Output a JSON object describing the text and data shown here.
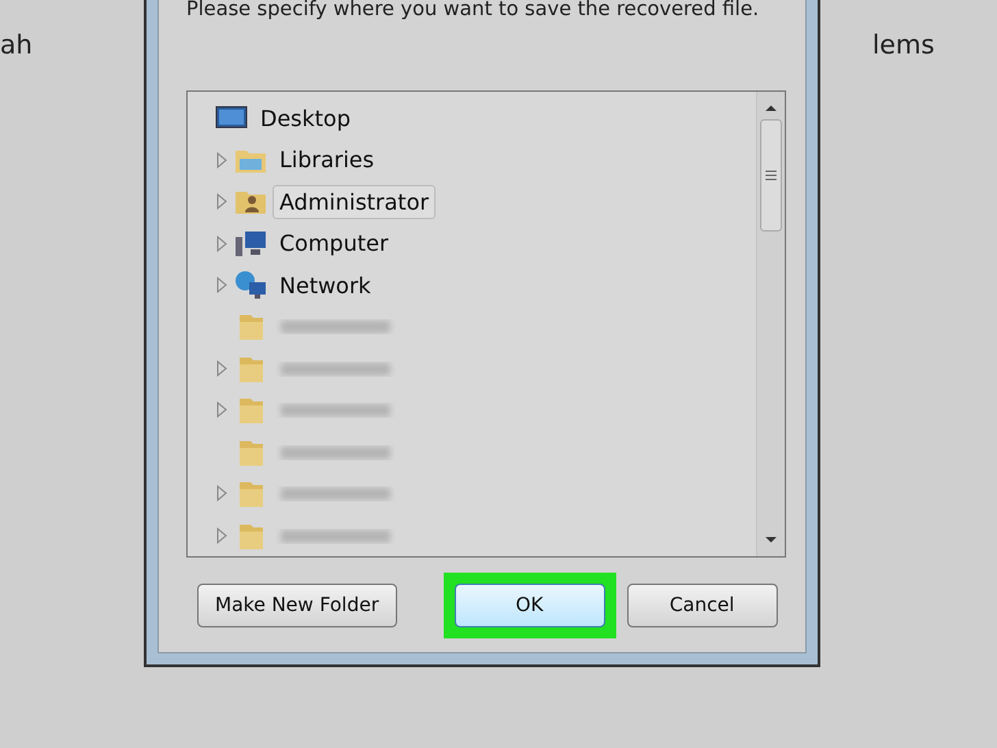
{
  "background": {
    "left_text": "ah",
    "right_text": "lems"
  },
  "dialog": {
    "prompt": "Please specify where you want to save the recovered file.",
    "tree": [
      {
        "kind": "desktop",
        "label": "Desktop",
        "expandable": false,
        "selected": false,
        "children": [
          {
            "kind": "libraries",
            "label": "Libraries",
            "expandable": true,
            "selected": false
          },
          {
            "kind": "user",
            "label": "Administrator",
            "expandable": true,
            "selected": true
          },
          {
            "kind": "computer",
            "label": "Computer",
            "expandable": true,
            "selected": false
          },
          {
            "kind": "network",
            "label": "Network",
            "expandable": true,
            "selected": false
          },
          {
            "kind": "blurred",
            "expandable": false,
            "selected": false
          },
          {
            "kind": "blurred",
            "expandable": true,
            "selected": false
          },
          {
            "kind": "blurred",
            "expandable": true,
            "selected": false
          },
          {
            "kind": "blurred",
            "expandable": false,
            "selected": false
          },
          {
            "kind": "blurred",
            "expandable": true,
            "selected": false
          },
          {
            "kind": "blurred",
            "expandable": true,
            "selected": false
          }
        ]
      }
    ],
    "buttons": [
      {
        "label": "Make New Folder",
        "highlighted": false,
        "default": false
      },
      {
        "label": "OK",
        "highlighted": true,
        "default": true
      },
      {
        "label": "Cancel",
        "highlighted": false,
        "default": false
      }
    ]
  }
}
